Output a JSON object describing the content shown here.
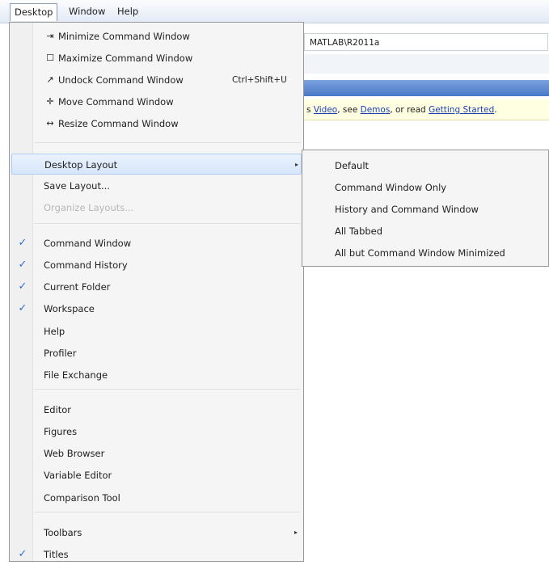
{
  "menubar": {
    "items": [
      {
        "label": "Desktop",
        "open": true
      },
      {
        "label": "Window"
      },
      {
        "label": "Help"
      }
    ]
  },
  "background": {
    "path": "MATLAB\\R2011a",
    "notice": {
      "prefix": "s ",
      "link1": "Video",
      "mid1": ", see ",
      "link2": "Demos",
      "mid2": ", or read ",
      "link3": "Getting Started",
      "suffix": "."
    }
  },
  "desktop_menu": {
    "items": [
      {
        "label": "Minimize Command Window",
        "icon": "minimize-icon",
        "glyph": "⇥"
      },
      {
        "label": "Maximize Command Window",
        "icon": "maximize-icon",
        "glyph": "☐"
      },
      {
        "label": "Undock Command Window",
        "icon": "undock-icon",
        "glyph": "↗",
        "shortcut": "Ctrl+Shift+U"
      },
      {
        "label": "Move Command Window",
        "icon": "move-icon",
        "glyph": "✛"
      },
      {
        "label": "Resize Command Window",
        "icon": "resize-icon",
        "glyph": "↔"
      },
      {
        "label": "Desktop Layout",
        "submenu": true,
        "highlighted": true
      },
      {
        "label": "Save Layout..."
      },
      {
        "label": "Organize Layouts...",
        "disabled": true
      },
      {
        "label": "Command Window",
        "checked": true
      },
      {
        "label": "Command History",
        "checked": true
      },
      {
        "label": "Current Folder",
        "checked": true
      },
      {
        "label": "Workspace",
        "checked": true
      },
      {
        "label": "Help"
      },
      {
        "label": "Profiler"
      },
      {
        "label": "File Exchange"
      },
      {
        "label": "Editor"
      },
      {
        "label": "Figures"
      },
      {
        "label": "Web Browser"
      },
      {
        "label": "Variable Editor"
      },
      {
        "label": "Comparison Tool"
      },
      {
        "label": "Toolbars",
        "submenu": true
      },
      {
        "label": "Titles",
        "checked": true
      }
    ],
    "check_glyph": "✓",
    "submenu_glyph": "▸"
  },
  "layout_submenu": {
    "items": [
      "Default",
      "Command Window Only",
      "History and Command Window",
      "All Tabbed",
      "All but Command Window Minimized"
    ]
  },
  "colors": {
    "highlight": "#d7e6fa",
    "check": "#2e6fd8",
    "titlebar": "#4a78c6",
    "notice_bg": "#ffffe1",
    "link": "#1a3fb5"
  }
}
